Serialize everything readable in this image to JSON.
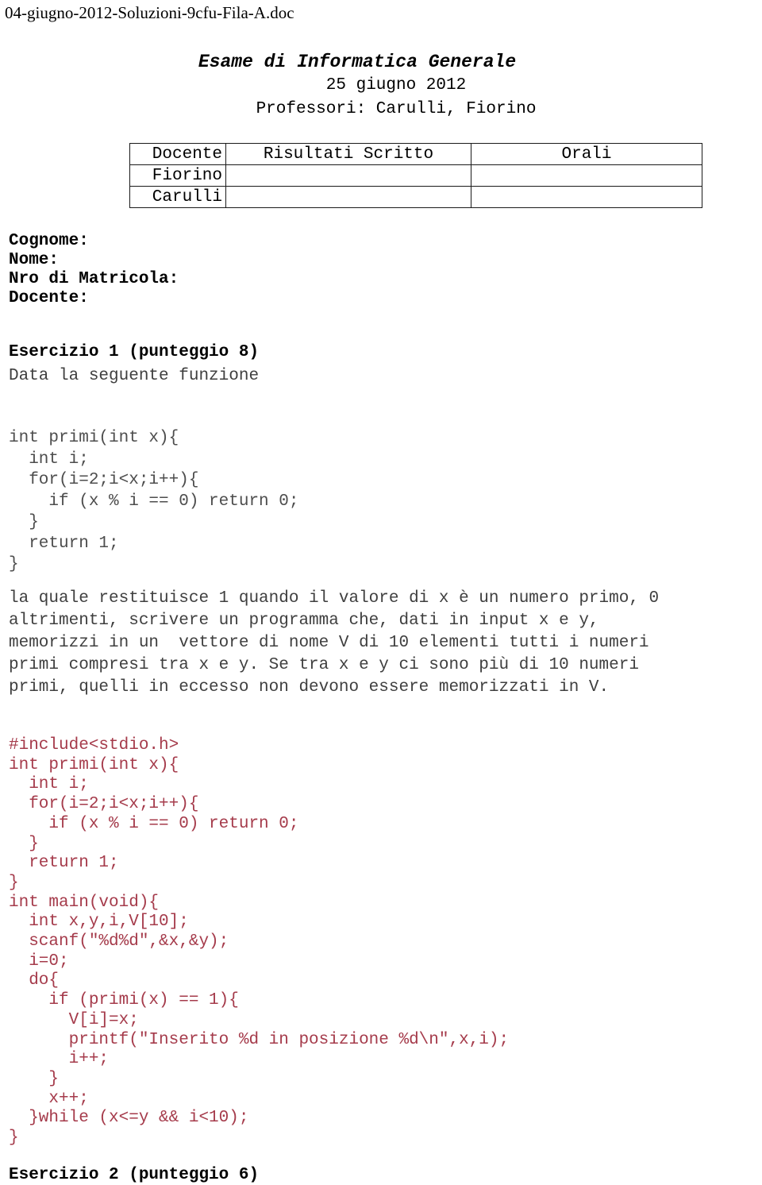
{
  "document": {
    "filename": "04-giugno-2012-Soluzioni-9cfu-Fila-A.doc"
  },
  "header": {
    "exam_title": "Esame di Informatica Generale",
    "exam_date": "25 giugno 2012",
    "professors": "Professori: Carulli, Fiorino"
  },
  "results_table": {
    "columns": [
      "Docente",
      "Risultati Scritto",
      "Orali"
    ],
    "rows": [
      {
        "docente": "Fiorino",
        "scritto": "",
        "orali": ""
      },
      {
        "docente": "Carulli",
        "scritto": "",
        "orali": ""
      }
    ]
  },
  "student_fields": [
    "Cognome:",
    "Nome:",
    "Nro di Matricola:",
    "Docente:"
  ],
  "exercise_1": {
    "heading": "Esercizio 1 (punteggio 8)",
    "subheading": "Data la seguente funzione",
    "given_code": "int primi(int x){\n  int i;\n  for(i=2;i<x;i++){\n    if (x % i == 0) return 0;\n  }\n  return 1;\n}",
    "description": "la quale restituisce 1 quando il valore di x è un numero primo, 0\naltrimenti, scrivere un programma che, dati in input x e y,\nmemorizzi in un  vettore di nome V di 10 elementi tutti i numeri\nprimi compresi tra x e y. Se tra x e y ci sono più di 10 numeri\nprimi, quelli in eccesso non devono essere memorizzati in V.",
    "solution_code": "#include<stdio.h>\nint primi(int x){\n  int i;\n  for(i=2;i<x;i++){\n    if (x % i == 0) return 0;\n  }\n  return 1;\n}\nint main(void){\n  int x,y,i,V[10];\n  scanf(\"%d%d\",&x,&y);\n  i=0;\n  do{\n    if (primi(x) == 1){\n      V[i]=x;\n      printf(\"Inserito %d in posizione %d\\n\",x,i);\n      i++;\n    }\n    x++;\n  }while (x<=y && i<10);\n}"
  },
  "exercise_2": {
    "heading": "Esercizio 2 (punteggio 6)"
  },
  "colors": {
    "body_text": "#000000",
    "muted_text": "#3f3f3f",
    "given_code": "#4d4d4d",
    "solution_code": "#a53b4b",
    "table_border": "#1a1a1a"
  }
}
